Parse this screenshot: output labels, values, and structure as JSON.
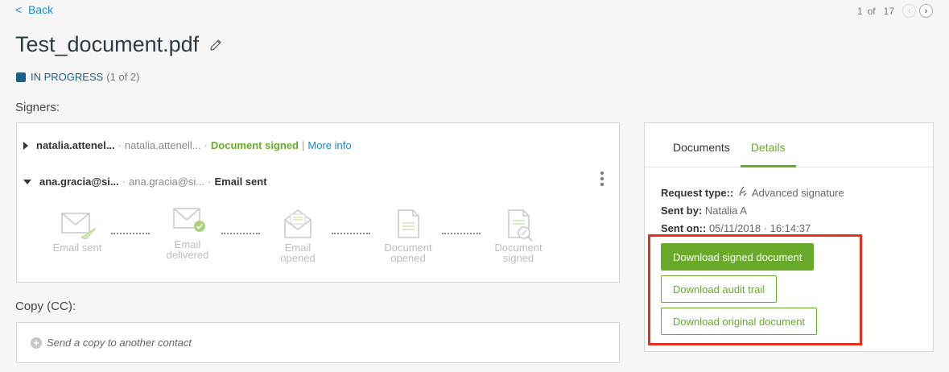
{
  "nav": {
    "back_label": "Back",
    "back_chevron": "<",
    "page_current": "1",
    "page_of": "of",
    "page_total": "17",
    "prev_icon": "‹",
    "next_icon": "›"
  },
  "document": {
    "title": "Test_document.pdf",
    "status_label": "IN PROGRESS",
    "status_count": "(1 of 2)",
    "status_color": "#1a5f86"
  },
  "signers": {
    "section_label": "Signers:",
    "rows": [
      {
        "name": "natalia.attenel...",
        "email": "natalia.attenell...",
        "state": "Document signed",
        "more_info": "More info"
      },
      {
        "name": "ana.gracia@si...",
        "email": "ana.gracia@si...",
        "state": "Email sent"
      }
    ],
    "separator": "·",
    "pipe": "|",
    "steps": [
      {
        "line1": "Email sent",
        "line2": "",
        "icon": "envelope-plane-icon"
      },
      {
        "line1": "Email",
        "line2": "delivered",
        "icon": "envelope-check-icon"
      },
      {
        "line1": "Email",
        "line2": "opened",
        "icon": "envelope-open-icon"
      },
      {
        "line1": "Document",
        "line2": "opened",
        "icon": "document-icon"
      },
      {
        "line1": "Document",
        "line2": "signed",
        "icon": "document-signed-icon"
      }
    ]
  },
  "cc": {
    "section_label": "Copy (CC):",
    "placeholder": "Send a copy to another contact",
    "plus_glyph": "+"
  },
  "panel": {
    "tabs": [
      {
        "label": "Documents",
        "active": false
      },
      {
        "label": "Details",
        "active": true
      }
    ],
    "request_type_label": "Request type::",
    "request_type_value": "Advanced signature",
    "sent_by_label": "Sent by:",
    "sent_by_value": "Natalia A",
    "sent_on_label": "Sent on::",
    "sent_on_value": "05/11/2018 · 16:14:37",
    "buttons": {
      "signed": "Download signed document",
      "audit": "Download audit trail",
      "original": "Download original document"
    }
  },
  "colors": {
    "accent_green": "#6aaa2a",
    "link_blue": "#1a8cc4",
    "highlight_red": "#e8301f"
  }
}
